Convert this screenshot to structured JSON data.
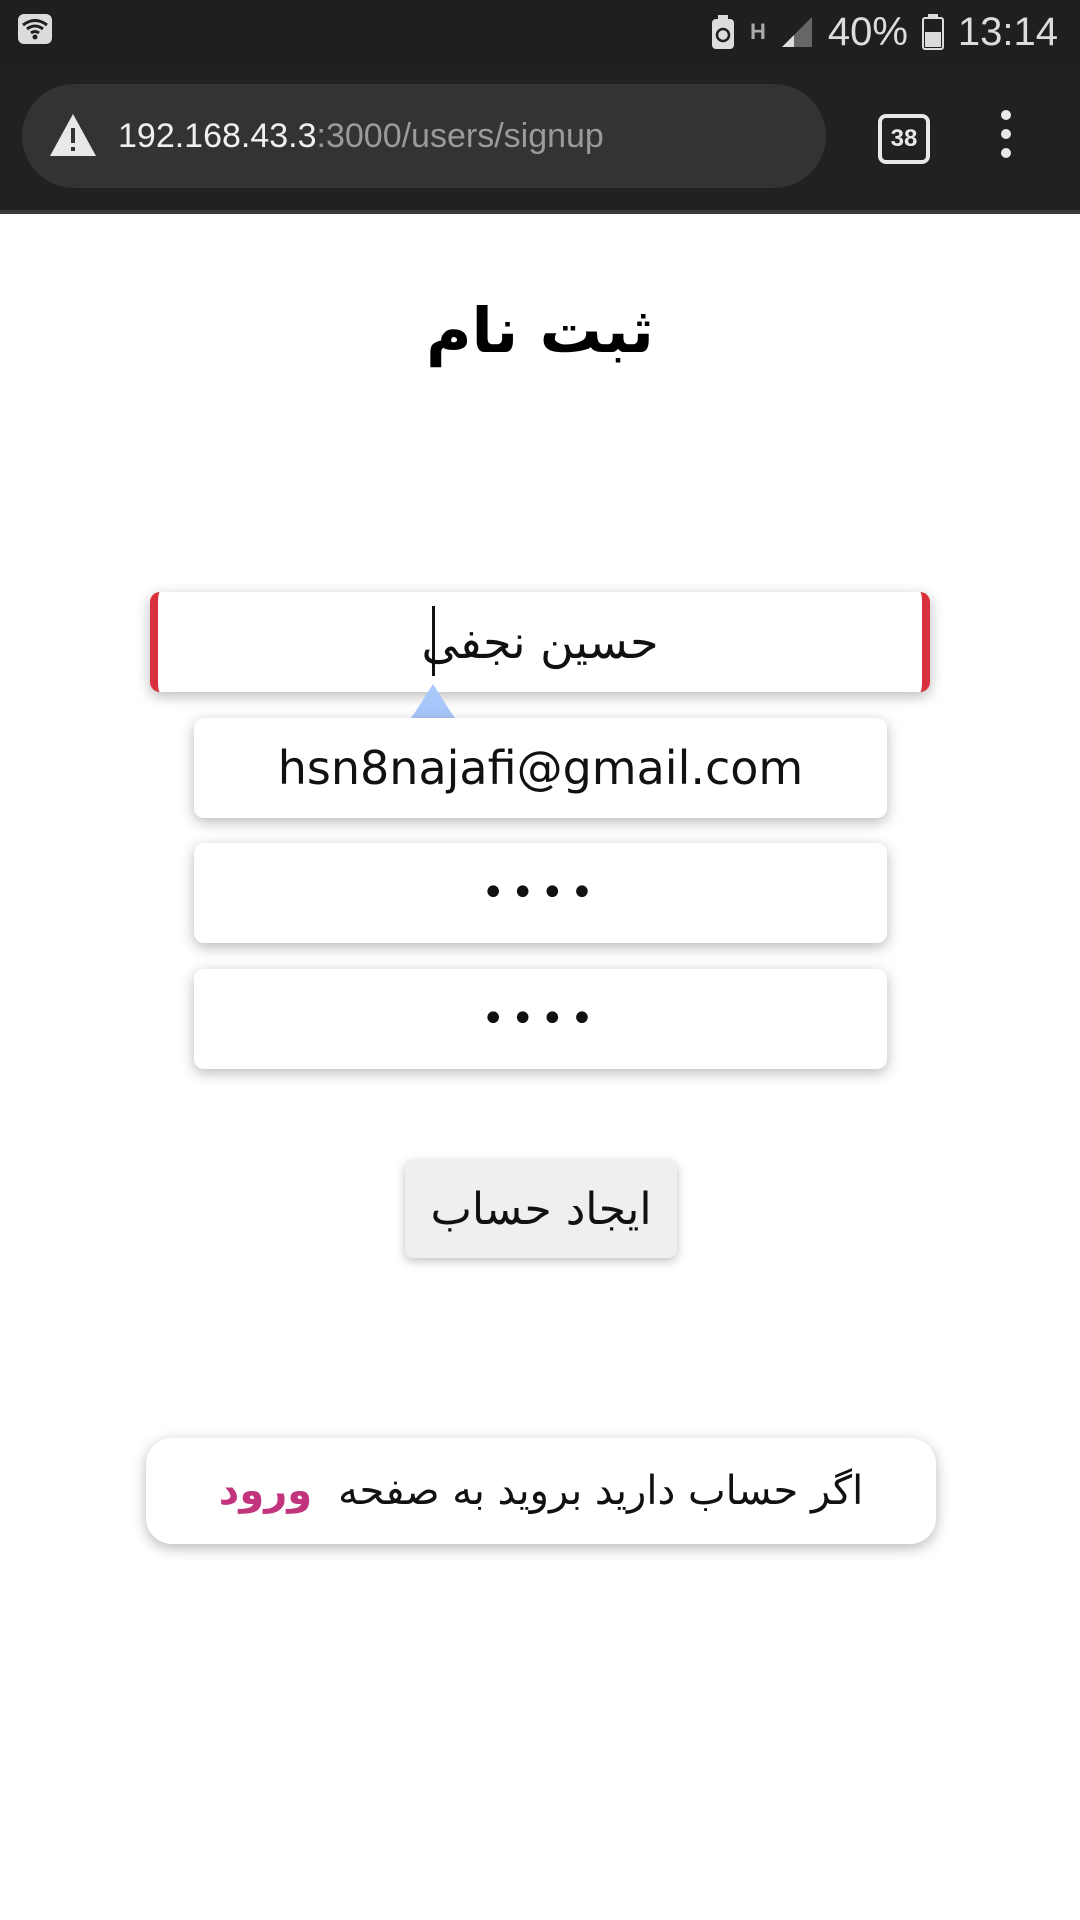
{
  "status_bar": {
    "battery_percent": "40%",
    "time": "13:14",
    "network_type": "H",
    "icons": [
      "wifi-icon",
      "battery-saver-icon",
      "signal-icon",
      "battery-icon"
    ]
  },
  "browser": {
    "url_host": "192.168.43.3",
    "url_path": ":3000/users/signup",
    "tab_count": "38",
    "icons": [
      "not-secure-warning-icon",
      "tab-switcher-icon",
      "menu-more-icon"
    ]
  },
  "page": {
    "title": "ثبت نام",
    "form": {
      "name_value": "حسین نجفی",
      "email_value": "hsn8najafi@gmail.com",
      "password_value": "••••",
      "password_confirm_value": "••••",
      "submit_label": "ایجاد حساب"
    },
    "login_prompt": {
      "text": "اگر حساب دارید بروید به صفحه",
      "link_label": "ورود"
    }
  },
  "colors": {
    "status_bar_bg": "#1f1f1f",
    "toolbar_bg": "#212121",
    "invalid_border": "#d9303e",
    "link": "#c2347e",
    "selection_handle": "#a8c7fa"
  }
}
